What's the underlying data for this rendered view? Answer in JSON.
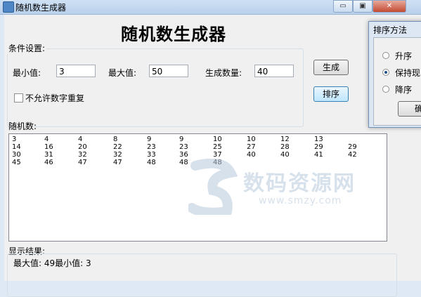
{
  "window": {
    "title": "随机数生成器",
    "controls": {
      "minimize": "▭",
      "maximize": "▣",
      "close": "✕"
    }
  },
  "heading": "随机数生成器",
  "conditions": {
    "group_label": "条件设置:",
    "min_label": "最小值:",
    "min_value": "3",
    "max_label": "最大值:",
    "max_value": "50",
    "count_label": "生成数量:",
    "count_value": "40",
    "no_repeat_label": "不允许数字重复",
    "no_repeat_checked": false
  },
  "buttons": {
    "generate": "生成",
    "sort": "排序"
  },
  "random": {
    "label": "随机数:",
    "rows": [
      [
        "3",
        "4",
        "4",
        "8",
        "9",
        "9",
        "10",
        "10",
        "12",
        "13"
      ],
      [
        "14",
        "16",
        "20",
        "22",
        "23",
        "23",
        "25",
        "27",
        "28",
        "29",
        "29"
      ],
      [
        "30",
        "31",
        "32",
        "32",
        "33",
        "36",
        "37",
        "40",
        "40",
        "41",
        "42"
      ],
      [
        "45",
        "46",
        "47",
        "47",
        "48",
        "48",
        "48"
      ]
    ]
  },
  "result": {
    "label": "显示结果:",
    "text": "最大值: 49最小值: 3"
  },
  "sort_dialog": {
    "title": "排序方法",
    "options": [
      {
        "label": "升序",
        "selected": false
      },
      {
        "label": "保持现",
        "selected": true
      },
      {
        "label": "降序",
        "selected": false
      }
    ],
    "ok_label": "确"
  },
  "watermark": {
    "text": "数码资源网",
    "url": "www.smzy.com"
  }
}
